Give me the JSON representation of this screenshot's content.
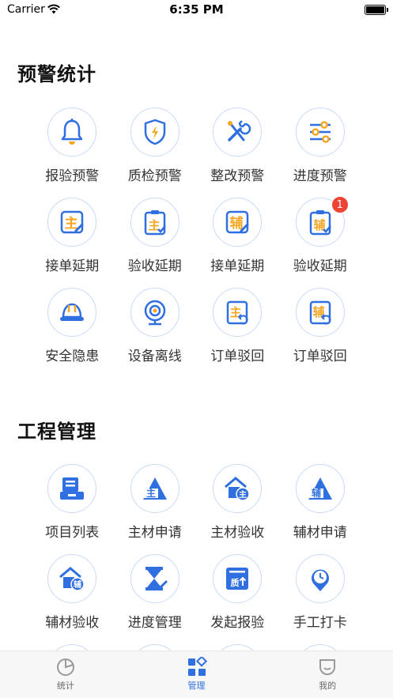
{
  "status_bar": {
    "carrier": "Carrier",
    "time": "6:35 PM"
  },
  "colors": {
    "accent": "#2f6fe0",
    "orange": "#f5a623",
    "badge": "#ee4433"
  },
  "sections": [
    {
      "title": "预警统计",
      "rows": [
        [
          {
            "label": "报验预警",
            "icon": "bell-icon"
          },
          {
            "label": "质检预警",
            "icon": "shield-bolt-icon"
          },
          {
            "label": "整改预警",
            "icon": "wrench-screwdriver-icon"
          },
          {
            "label": "进度预警",
            "icon": "sliders-icon"
          }
        ],
        [
          {
            "label": "接单延期",
            "icon": "main-material-edit-icon",
            "glyph": "主"
          },
          {
            "label": "验收延期",
            "icon": "main-material-clipboard-icon",
            "glyph": "主"
          },
          {
            "label": "接单延期",
            "icon": "aux-material-edit-icon",
            "glyph": "辅"
          },
          {
            "label": "验收延期",
            "icon": "aux-material-clipboard-icon",
            "glyph": "辅",
            "badge": "1"
          }
        ],
        [
          {
            "label": "安全隐患",
            "icon": "hard-hat-icon"
          },
          {
            "label": "设备离线",
            "icon": "webcam-icon"
          },
          {
            "label": "订单驳回",
            "icon": "main-order-return-icon",
            "glyph": "主"
          },
          {
            "label": "订单驳回",
            "icon": "aux-order-return-icon",
            "glyph": "辅"
          }
        ]
      ]
    },
    {
      "title": "工程管理",
      "rows": [
        [
          {
            "label": "项目列表",
            "icon": "project-list-icon"
          },
          {
            "label": "主材申请",
            "icon": "main-material-apply-icon",
            "glyph": "主"
          },
          {
            "label": "主材验收",
            "icon": "main-material-accept-icon",
            "glyph": "主"
          },
          {
            "label": "辅材申请",
            "icon": "aux-material-apply-icon",
            "glyph": "辅"
          }
        ],
        [
          {
            "label": "辅材验收",
            "icon": "aux-material-accept-icon",
            "glyph": "辅"
          },
          {
            "label": "进度管理",
            "icon": "hourglass-icon"
          },
          {
            "label": "发起报验",
            "icon": "quality-upload-icon",
            "glyph": "质"
          },
          {
            "label": "手工打卡",
            "icon": "clock-pin-icon"
          }
        ]
      ]
    }
  ],
  "tabbar": [
    {
      "label": "统计",
      "icon": "pie-chart-icon",
      "active": false
    },
    {
      "label": "管理",
      "icon": "grid-manage-icon",
      "active": true
    },
    {
      "label": "我的",
      "icon": "profile-icon",
      "active": false
    }
  ]
}
